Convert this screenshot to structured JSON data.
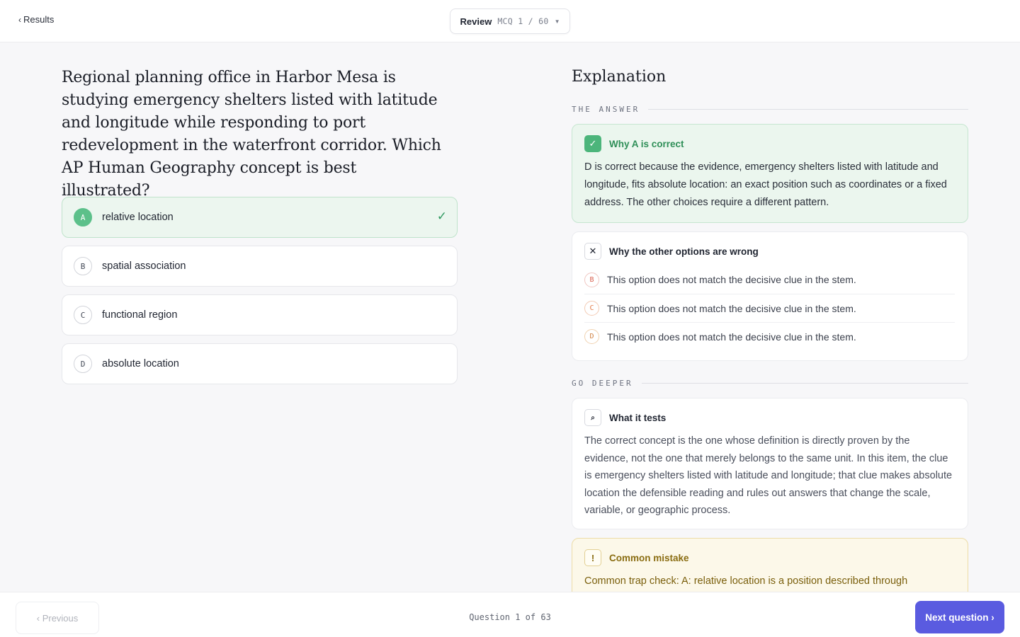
{
  "header": {
    "back_label": "Results",
    "mode_label": "Review",
    "mode_count": "MCQ 1 / 60"
  },
  "question": {
    "stem": "Regional planning office in Harbor Mesa is studying emergency shelters listed with latitude and longitude while responding to port redevelopment in the waterfront corridor. Which AP Human Geography concept is best illustrated?",
    "choices": [
      {
        "letter": "A",
        "text": "relative location",
        "state": "correct"
      },
      {
        "letter": "B",
        "text": "spatial association",
        "state": "neutral"
      },
      {
        "letter": "C",
        "text": "functional region",
        "state": "neutral"
      },
      {
        "letter": "D",
        "text": "absolute location",
        "state": "neutral"
      }
    ]
  },
  "explanation": {
    "title": "Explanation",
    "answer_label": "THE ANSWER",
    "correct_card": {
      "heading": "Why A is correct",
      "body": "D is correct because the evidence, emergency shelters listed with latitude and longitude, fits absolute location: an exact position such as coordinates or a fixed address. The other choices require a different pattern."
    },
    "wrong_card": {
      "heading": "Why the other options are wrong",
      "items": [
        {
          "letter": "B",
          "text": "This option does not match the decisive clue in the stem."
        },
        {
          "letter": "C",
          "text": "This option does not match the decisive clue in the stem."
        },
        {
          "letter": "D",
          "text": "This option does not match the decisive clue in the stem."
        }
      ]
    },
    "deeper_label": "GO DEEPER",
    "tests_card": {
      "heading": "What it tests",
      "body": "The correct concept is the one whose definition is directly proven by the evidence, not the one that merely belongs to the same unit. In this item, the clue is emergency shelters listed with latitude and longitude; that clue makes absolute location the defensible reading and rules out answers that change the scale, variable, or geographic process."
    },
    "mistake_card": {
      "heading": "Common mistake",
      "body": "Common trap check: A: relative location is a position described through"
    }
  },
  "footer": {
    "prev_label": "Previous",
    "progress": "Question 1 of 63",
    "next_label": "Next question"
  },
  "colors": {
    "accent": "#5a5be0",
    "correct": "#4cb57b",
    "warning": "#8a6d12"
  }
}
